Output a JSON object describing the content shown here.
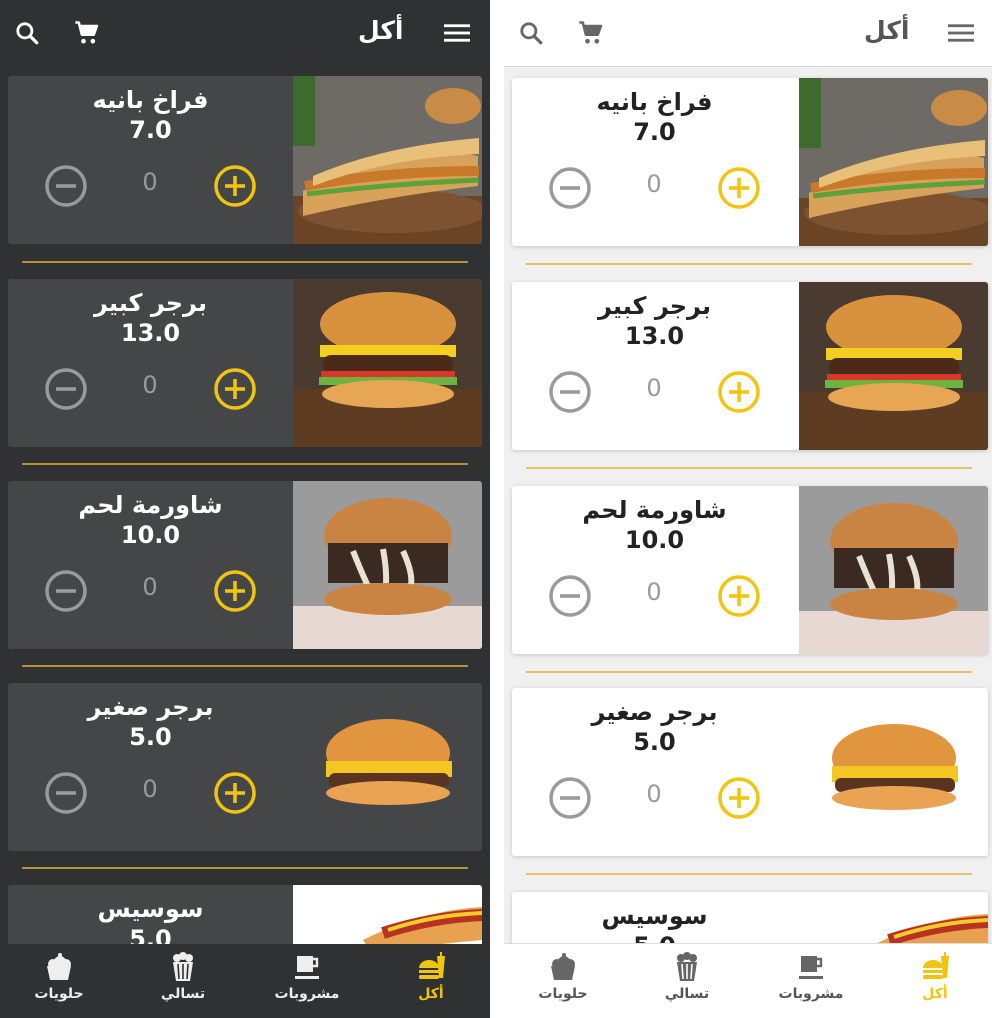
{
  "app": {
    "title": "أكل",
    "colors": {
      "accent": "#f1c40f",
      "dark_bg": "#2f3133",
      "dark_card": "#454648",
      "light_card": "#ffffff",
      "divider": "#e0b43a"
    }
  },
  "items": [
    {
      "name": "فراخ بانيه",
      "price": "7.0",
      "qty": "0",
      "image": "chicken-sandwich"
    },
    {
      "name": "برجر كبير",
      "price": "13.0",
      "qty": "0",
      "image": "big-burger"
    },
    {
      "name": "شاورمة لحم",
      "price": "10.0",
      "qty": "0",
      "image": "shawarma"
    },
    {
      "name": "برجر صغير",
      "price": "5.0",
      "qty": "0",
      "image": "small-burger"
    },
    {
      "name": "سوسيس",
      "price": "5.0",
      "qty": "0",
      "image": "hotdog"
    }
  ],
  "tabs": [
    {
      "label": "أكل",
      "icon": "fastfood-icon",
      "active": true
    },
    {
      "label": "مشروبات",
      "icon": "drink-icon",
      "active": false
    },
    {
      "label": "تسالي",
      "icon": "popcorn-icon",
      "active": false
    },
    {
      "label": "حلويات",
      "icon": "cake-icon",
      "active": false
    }
  ]
}
